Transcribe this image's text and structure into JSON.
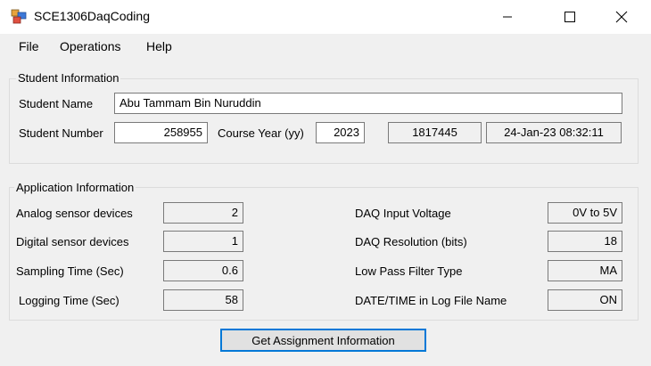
{
  "window": {
    "title": "SCE1306DaqCoding"
  },
  "menu": {
    "file": "File",
    "operations": "Operations",
    "help": "Help"
  },
  "student": {
    "group_title": "Student Information",
    "name_label": "Student Name",
    "name_value": "Abu Tammam Bin Nuruddin",
    "number_label": "Student Number",
    "number_value": "258955",
    "course_year_label": "Course Year (yy)",
    "course_year_value": "2023",
    "code_value": "1817445",
    "datetime_value": "24-Jan-23 08:32:11"
  },
  "application": {
    "group_title": "Application Information",
    "left": [
      {
        "label": "Analog sensor devices",
        "value": "2"
      },
      {
        "label": "Digital sensor devices",
        "value": "1"
      },
      {
        "label": "Sampling Time (Sec)",
        "value": "0.6"
      },
      {
        "label": "Logging Time (Sec)",
        "value": "58"
      }
    ],
    "right": [
      {
        "label": "DAQ Input Voltage",
        "value": "0V to 5V"
      },
      {
        "label": "DAQ Resolution (bits)",
        "value": "18"
      },
      {
        "label": "Low Pass Filter Type",
        "value": "MA"
      },
      {
        "label": "DATE/TIME in Log File Name",
        "value": "ON"
      }
    ]
  },
  "button": {
    "get_assignment": "Get Assignment Information"
  },
  "colors": {
    "accent": "#0078d7",
    "window_bg": "#f0f0f0",
    "titlebar_bg": "#ffffff"
  }
}
